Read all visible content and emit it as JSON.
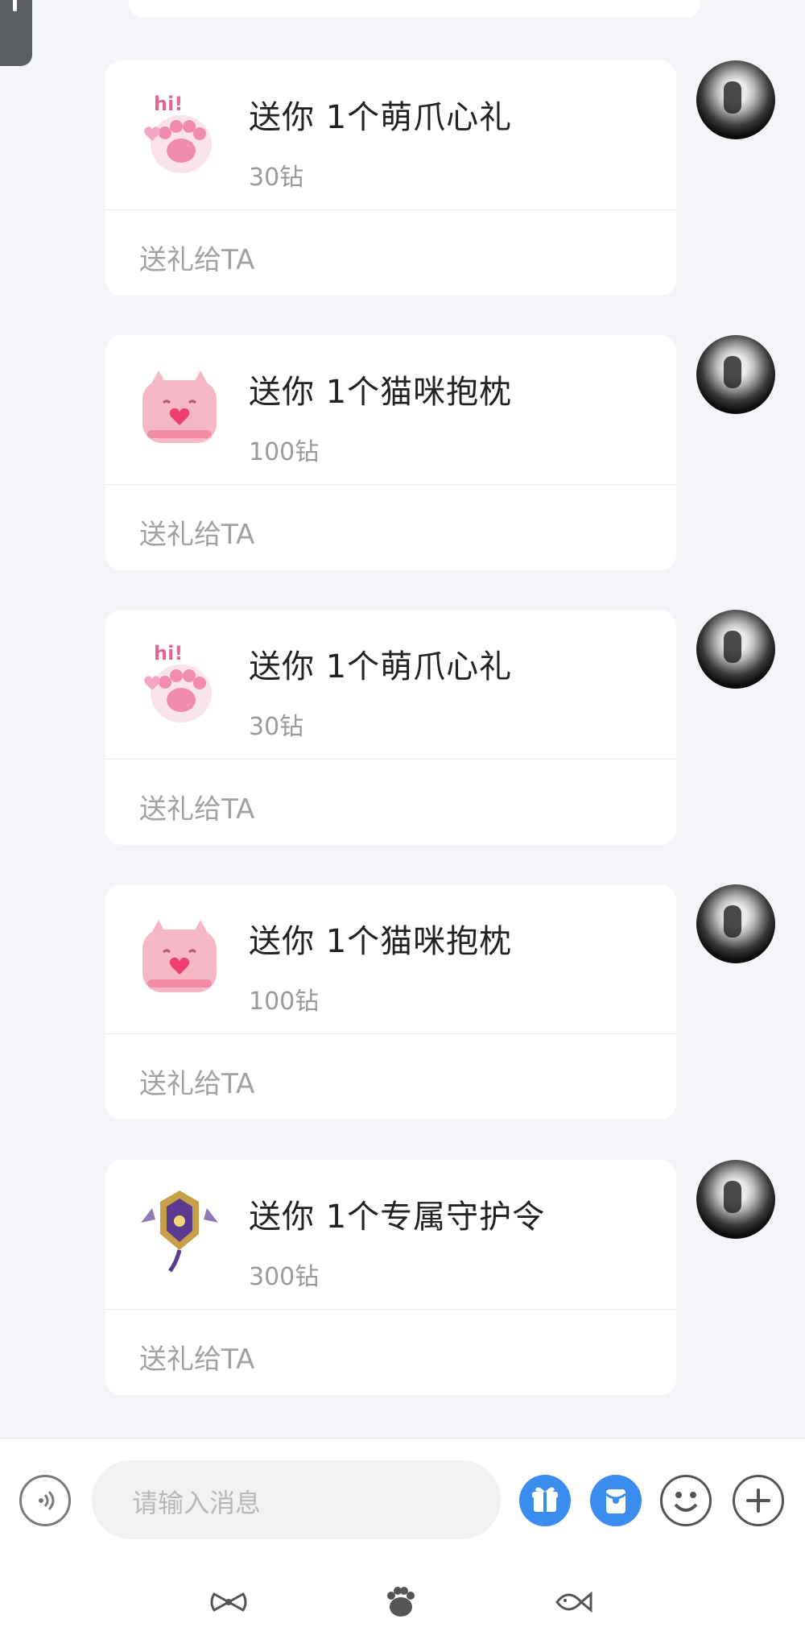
{
  "colors": {
    "background": "#f3f5f8",
    "card": "#ffffff",
    "text_primary": "#222222",
    "text_secondary": "#9a9a9a",
    "accent_blue": "#3b8cef"
  },
  "messages": [
    {
      "gift_icon": "paw-heart-hi-icon",
      "title": "送你 1个萌爪心礼",
      "price": "30钻",
      "action": "送礼给TA"
    },
    {
      "gift_icon": "cat-pillow-icon",
      "title": "送你 1个猫咪抱枕",
      "price": "100钻",
      "action": "送礼给TA"
    },
    {
      "gift_icon": "paw-heart-hi-icon",
      "title": "送你 1个萌爪心礼",
      "price": "30钻",
      "action": "送礼给TA"
    },
    {
      "gift_icon": "cat-pillow-icon",
      "title": "送你 1个猫咪抱枕",
      "price": "100钻",
      "action": "送礼给TA"
    },
    {
      "gift_icon": "guardian-badge-icon",
      "title": "送你 1个专属守护令",
      "price": "300钻",
      "action": "送礼给TA"
    }
  ],
  "composer": {
    "placeholder": "请输入消息",
    "icons": [
      "voice-icon",
      "gift-icon",
      "red-packet-icon",
      "emoji-icon",
      "plus-icon"
    ]
  },
  "bottom_tabs": [
    {
      "icon": "bow-icon"
    },
    {
      "icon": "paw-icon"
    },
    {
      "icon": "fish-icon"
    }
  ]
}
